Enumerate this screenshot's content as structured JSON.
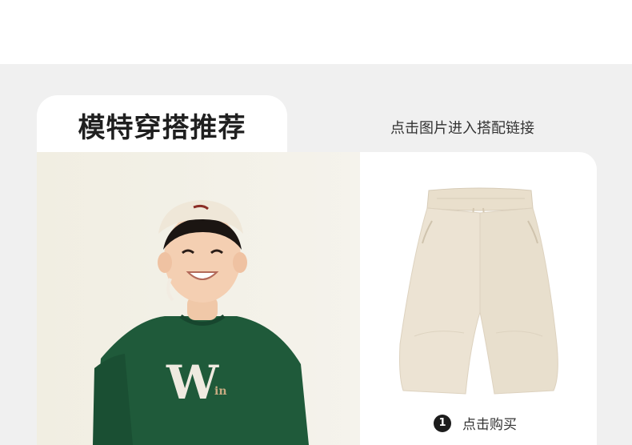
{
  "section": {
    "title": "模特穿搭推荐",
    "hint": "点击图片进入搭配链接"
  },
  "model": {
    "cap_logo": "",
    "shirt_letter": "W",
    "shirt_small_text": "in"
  },
  "product": {
    "step_number": "1",
    "buy_label": "点击购买"
  },
  "colors": {
    "panel_bg": "#f0f0f0",
    "shirt_green": "#1f5a3a",
    "pants_beige": "#ece3d3",
    "badge_black": "#1c1c1c"
  }
}
